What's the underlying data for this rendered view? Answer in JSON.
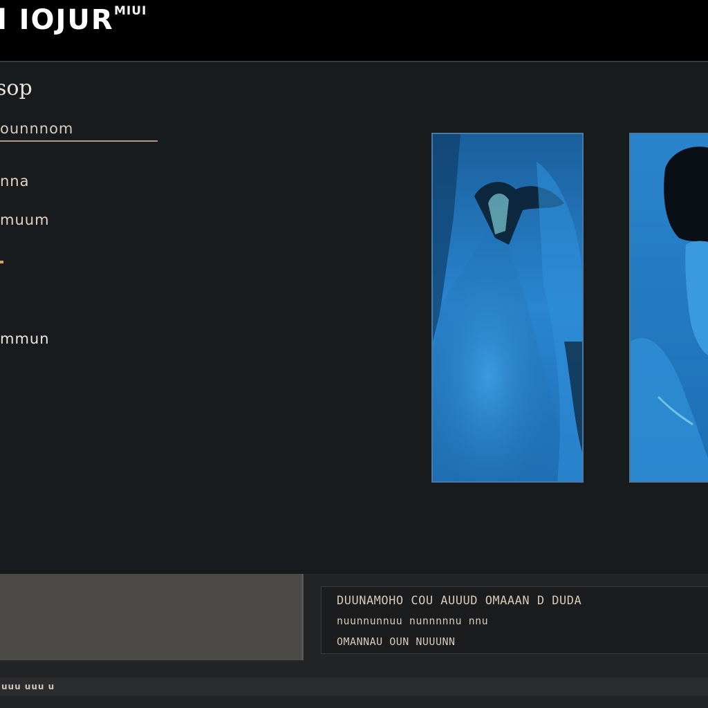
{
  "titlebar": {
    "title": "l IOJUR",
    "subtitle": "MIUI"
  },
  "sidebar": {
    "section_title": "sop",
    "section_subtitle": "ounnnom",
    "items": [
      {
        "label": "nna"
      },
      {
        "label": "muum"
      },
      {
        "label": "mmun"
      }
    ]
  },
  "gallery": {
    "images": [
      {
        "name": "blue-figure-photo-1"
      },
      {
        "name": "blue-figure-photo-2"
      }
    ]
  },
  "info": {
    "lines": [
      "DUUNAMOHO COU AUUUD OMAAAN D DUDA",
      "nuunnunnuu  nunnnnnu  nnu",
      "OMANNAU OUN  NUUUNN"
    ]
  },
  "status": {
    "text": "uuu uuu u"
  },
  "colors": {
    "background": "#000000",
    "panel": "#181b1e",
    "accent_text": "#e4d3c1",
    "photo_blue": "#1d6db0"
  }
}
